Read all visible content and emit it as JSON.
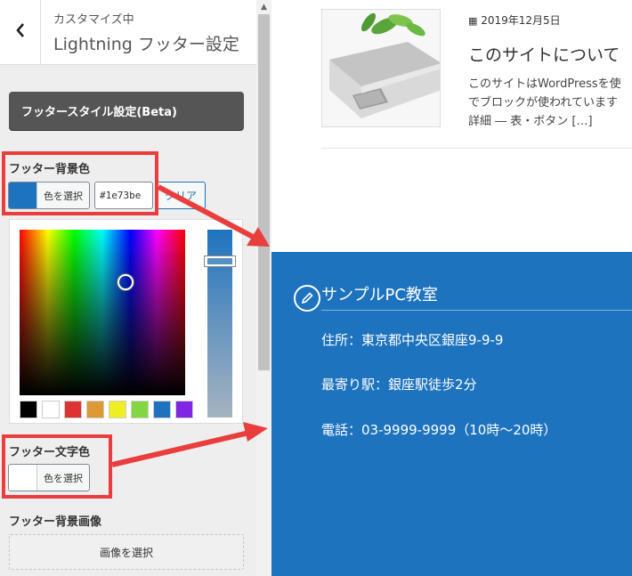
{
  "customizer": {
    "header": {
      "back_icon": "chevron-left-icon",
      "subtitle": "カスタマイズ中",
      "title": "Lightning フッター設定"
    },
    "footer_style_button": "フッタースタイル設定(Beta)",
    "footer_bg_color": {
      "label": "フッター背景色",
      "select_label": "色を選択",
      "hex_value": "#1e73be",
      "clear_label": "クリア",
      "swatch_color": "#1e73be"
    },
    "color_picker": {
      "palette": [
        "#000000",
        "#ffffff",
        "#dd3333",
        "#dd9933",
        "#eeee22",
        "#81d742",
        "#1e73be",
        "#8224e3"
      ]
    },
    "footer_text_color": {
      "label": "フッター文字色",
      "select_label": "色を選択",
      "swatch_color": "#ffffff"
    },
    "footer_bg_image": {
      "label": "フッター背景画像",
      "select_label": "画像を選択"
    }
  },
  "preview": {
    "post": {
      "date_icon": "calendar-icon",
      "date": "2019年12月5日",
      "title": "このサイトについて",
      "excerpt_line1": "このサイトはWordPressを使",
      "excerpt_line2": "でブロックが使われています",
      "excerpt_line3": "詳細 ― 表・ボタン […]"
    },
    "footer": {
      "bg_color": "#1e73be",
      "icon": "pencil-icon",
      "title": "サンプルPC教室",
      "address": "住所：東京都中央区銀座9-9-9",
      "station": "最寄り駅：銀座駅徒歩2分",
      "phone": "電話：03-9999-9999（10時〜20時）"
    }
  },
  "annotation_color": "#ea3d3d"
}
